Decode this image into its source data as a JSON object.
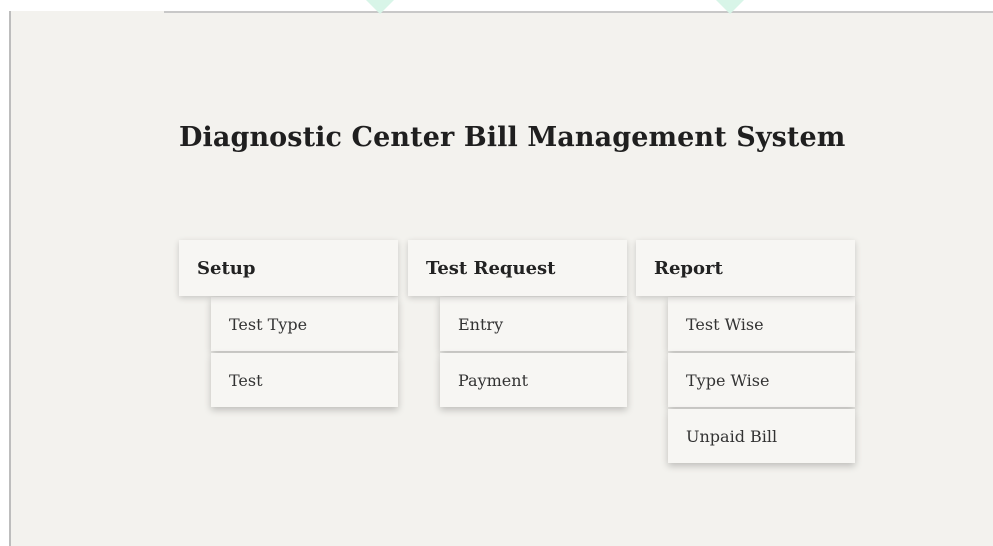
{
  "title": "Diagnostic Center Bill Management System",
  "menus": [
    {
      "label": "Setup",
      "items": [
        "Test Type",
        "Test"
      ]
    },
    {
      "label": "Test Request",
      "items": [
        "Entry",
        "Payment"
      ]
    },
    {
      "label": "Report",
      "items": [
        "Test Wise",
        "Type Wise",
        "Unpaid Bill"
      ]
    }
  ],
  "colors": {
    "background": "#f3f2ee",
    "tile": "#f7f6f3",
    "text": "#1f1f1f",
    "accent_decor": "#d8f5e8"
  }
}
